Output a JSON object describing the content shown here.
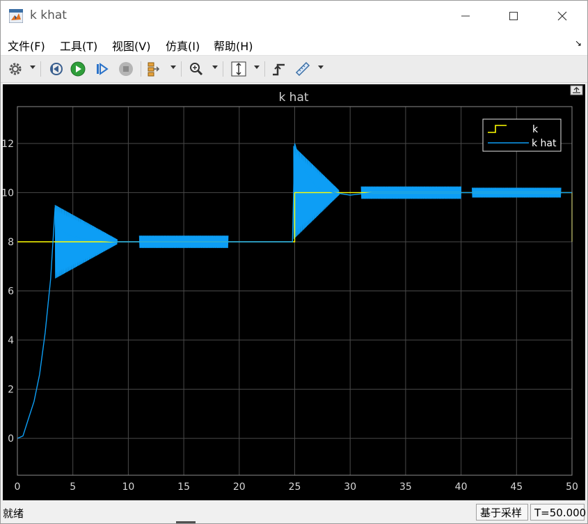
{
  "window": {
    "title": "k khat"
  },
  "menu": [
    "文件(F)",
    "工具(T)",
    "视图(V)",
    "仿真(I)",
    "帮助(H)"
  ],
  "toolbar": {
    "buttons": [
      "settings-icon",
      "step-back-icon",
      "run-icon",
      "step-forward-icon",
      "stop-icon",
      "signal-hierarchy-icon",
      "zoom-icon",
      "fit-axes-icon",
      "triggers-icon",
      "measurements-icon"
    ]
  },
  "chart_data": {
    "type": "line",
    "title": "k hat",
    "xlim": [
      0,
      50
    ],
    "ylim": [
      -1.5,
      13.5
    ],
    "x_ticks": [
      "0",
      "5",
      "10",
      "15",
      "20",
      "25",
      "30",
      "35",
      "40",
      "45",
      "50"
    ],
    "y_ticks": [
      "0",
      "2",
      "4",
      "6",
      "8",
      "10",
      "12"
    ],
    "grid": true,
    "legend_position": "top-right",
    "series": [
      {
        "name": "k",
        "color": "#ffff00",
        "points": [
          [
            0,
            8
          ],
          [
            25,
            8
          ],
          [
            25,
            10
          ],
          [
            50,
            10
          ],
          [
            50,
            8
          ]
        ]
      },
      {
        "name": "k hat",
        "color": "#0d9ef5",
        "points": [
          [
            0,
            0
          ],
          [
            0.5,
            0.1
          ],
          [
            1,
            0.8
          ],
          [
            1.5,
            1.5
          ],
          [
            2,
            2.6
          ],
          [
            2.5,
            4.3
          ],
          [
            3,
            6.5
          ],
          [
            3.4,
            9.4
          ],
          [
            3.7,
            8.6
          ],
          [
            4.5,
            8.3
          ],
          [
            6,
            8.1
          ],
          [
            9,
            8.0
          ],
          [
            12,
            8.0
          ],
          [
            15,
            8.0
          ],
          [
            20,
            8.0
          ],
          [
            24.8,
            8.0
          ],
          [
            25,
            12.0
          ],
          [
            25.5,
            11.2
          ],
          [
            27,
            10.2
          ],
          [
            28.5,
            10.0
          ],
          [
            30,
            9.9
          ],
          [
            32,
            10.0
          ],
          [
            36,
            10.0
          ],
          [
            40,
            10.0
          ],
          [
            45,
            10.0
          ],
          [
            50,
            10.0
          ]
        ]
      }
    ],
    "oscillation_bands": [
      {
        "x": [
          3.4,
          9
        ],
        "amp_start": 1.5,
        "amp_end": 0.1,
        "center": 8
      },
      {
        "x": [
          11,
          19
        ],
        "amp_start": 0.25,
        "amp_end": 0.25,
        "center": 8
      },
      {
        "x": [
          24.9,
          29
        ],
        "amp_start": 1.9,
        "amp_end": 0.1,
        "center": 10
      },
      {
        "x": [
          31,
          40
        ],
        "amp_start": 0.25,
        "amp_end": 0.25,
        "center": 10
      },
      {
        "x": [
          41,
          49
        ],
        "amp_start": 0.2,
        "amp_end": 0.2,
        "center": 10
      }
    ]
  },
  "status": {
    "left": "就绪",
    "sample_mode": "基于采样",
    "time": "T=50.000"
  }
}
